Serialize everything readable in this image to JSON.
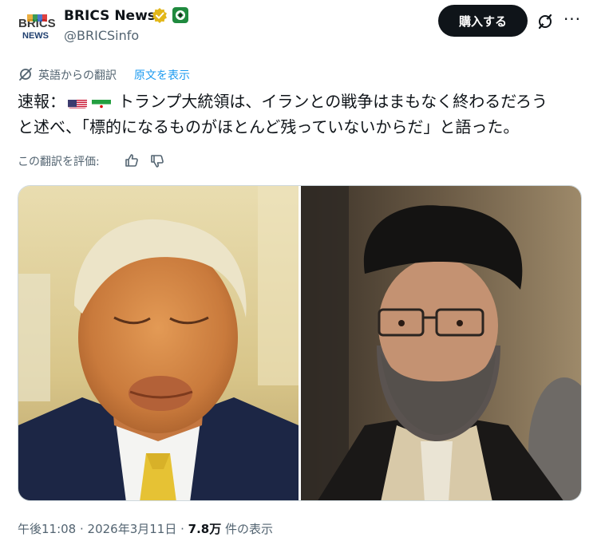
{
  "author": {
    "display_name": "BRICS News",
    "handle": "@BRICSinfo",
    "avatar_text_top": "BRICS",
    "avatar_text_bottom": "NEWS"
  },
  "header": {
    "subscribe_label": "購入する",
    "more_label": "···"
  },
  "translation": {
    "notice": "英語からの翻訳",
    "show_original": "原文を表示",
    "rate_label": "この翻訳を評価:"
  },
  "tweet": {
    "prefix": "速報：",
    "line1": "トランプ大統領は、イランとの戦争はまもなく終わるだろう",
    "line2": "と述べ、「標的になるものがほとんど残っていないからだ」と語った。"
  },
  "meta": {
    "time": "午後11:08",
    "separator1": " · ",
    "date": "2026年3月11日",
    "separator2": " · ",
    "views": "7.8万",
    "views_label": " 件の表示"
  },
  "colors": {
    "accent": "#1d9bf0",
    "text": "#0f1419",
    "secondary": "#536471",
    "verified_gold": "#e2b719"
  },
  "icons": {
    "verified": "verified-gold-badge-icon",
    "affiliate": "brics-affiliate-icon",
    "grok": "grok-icon",
    "more": "more-icon",
    "translate": "translate-icon",
    "thumbs_up": "thumbs-up-icon",
    "thumbs_down": "thumbs-down-icon"
  }
}
